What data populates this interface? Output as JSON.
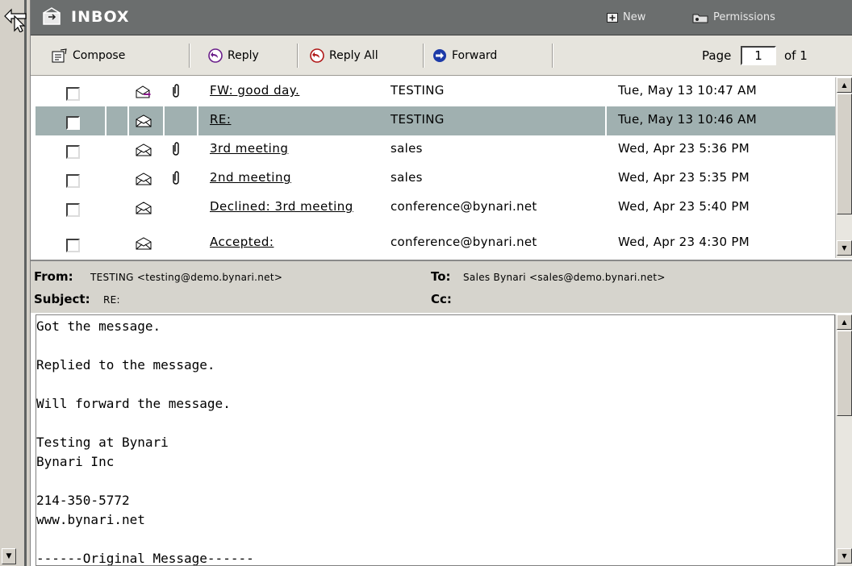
{
  "title_bar": {
    "title": "INBOX",
    "new_label": "New",
    "permissions_label": "Permissions"
  },
  "toolbar": {
    "compose": "Compose",
    "reply": "Reply",
    "reply_all": "Reply All",
    "forward": "Forward",
    "page_label": "Page",
    "page_value": "1",
    "page_of": "of 1"
  },
  "messages": [
    {
      "subject": "FW: good day.",
      "from": "TESTING",
      "date": "Tue, May 13 10:47 AM",
      "attachment": true,
      "icon": "forwarded-mail-icon",
      "selected": false
    },
    {
      "subject": "RE:",
      "from": "TESTING",
      "date": "Tue, May 13 10:46 AM",
      "attachment": false,
      "icon": "open-mail-icon",
      "selected": true
    },
    {
      "subject": "3rd meeting",
      "from": "sales",
      "date": "Wed, Apr 23 5:36 PM",
      "attachment": true,
      "icon": "open-mail-icon",
      "selected": false
    },
    {
      "subject": "2nd meeting",
      "from": "sales",
      "date": "Wed, Apr 23 5:35 PM",
      "attachment": true,
      "icon": "open-mail-icon",
      "selected": false
    },
    {
      "subject": "Declined: 3rd meeting",
      "from": "conference@bynari.net",
      "date": "Wed, Apr 23 5:40 PM",
      "attachment": false,
      "icon": "open-mail-icon",
      "selected": false
    },
    {
      "subject": "Accepted:",
      "from": "conference@bynari.net",
      "date": "Wed, Apr 23 4:30 PM",
      "attachment": false,
      "icon": "open-mail-icon",
      "selected": false
    }
  ],
  "header": {
    "from_label": "From:",
    "from_value": "TESTING <testing@demo.bynari.net>",
    "to_label": "To:",
    "to_value": "Sales Bynari <sales@demo.bynari.net>",
    "subject_label": "Subject:",
    "subject_value": "RE:",
    "cc_label": "Cc:"
  },
  "body": {
    "text": "Got the message.\n\nReplied to the message.\n\nWill forward the message.\n\nTesting at Bynari\nBynari Inc\n\n214-350-5772\nwww.bynari.net\n\n------Original Message------"
  },
  "colors": {
    "title_bar": "#6b6e6e",
    "toolbar": "#e6e4dd",
    "selected_row": "#a0b0b0",
    "header_panel": "#d6d4cd"
  }
}
